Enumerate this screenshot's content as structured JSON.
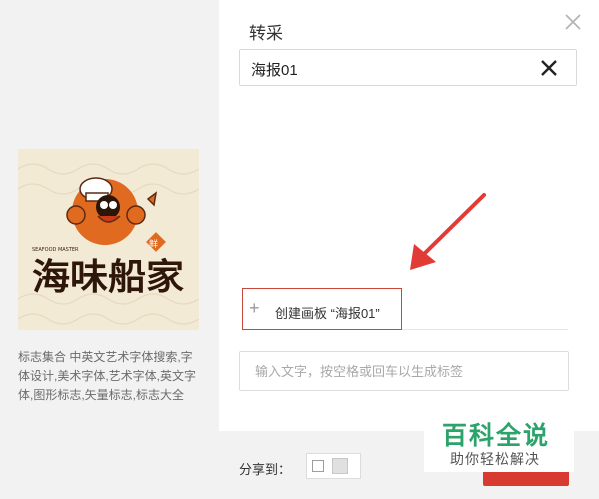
{
  "dialog": {
    "title": "转采",
    "board_value": "海报01",
    "create_board_label": "创建画板 “海报01”",
    "tag_placeholder": "输入文字，按空格或回车以生成标签",
    "share_label": "分享到："
  },
  "preview": {
    "description": "标志集合 中英文艺术字体搜索,字体设计,美术字体,艺术字体,英文字体,图形标志,矢量标志,标志大全",
    "logo_text": "海味船家",
    "logo_badge": "鲜",
    "logo_small_text": "SEAFOOD MASTER"
  },
  "watermark": {
    "title": "百科全说",
    "subtitle": "助你轻松解决"
  },
  "colors": {
    "accent": "#d63a30",
    "create_border": "#c9483b",
    "watermark_green": "#2ca36a",
    "panel_bg": "#f2f2f2"
  },
  "icons": [
    "close-icon",
    "clear-icon",
    "plus-icon",
    "checkbox-icon",
    "star-icon",
    "arrow-annotation"
  ]
}
